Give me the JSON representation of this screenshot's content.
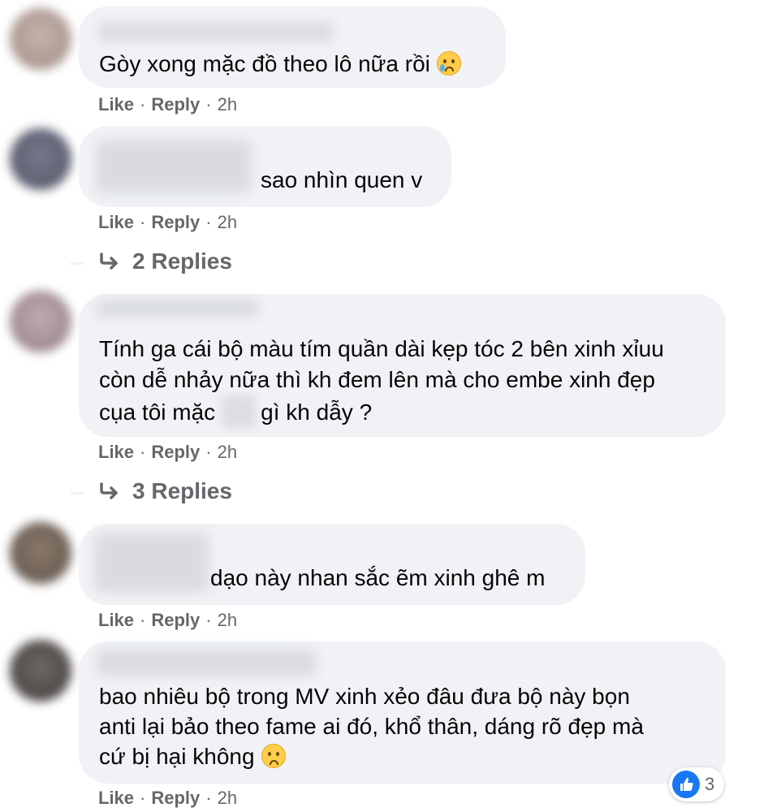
{
  "comments": [
    {
      "lines": [
        "Gòy xong mặc đồ theo lô nữa rồi"
      ],
      "emoji": "crying-smile-emoji",
      "actions": {
        "like": "Like",
        "reply": "Reply",
        "time": "2h"
      }
    },
    {
      "lines": [
        "sao nhìn quen v"
      ],
      "actions": {
        "like": "Like",
        "reply": "Reply",
        "time": "2h"
      },
      "replies": "2 Replies"
    },
    {
      "lines": [
        "Tính ga cái bộ màu tím quần dài kẹp tóc 2 bên xinh xỉuu",
        "còn dễ nhảy nữa thì kh đem lên mà cho embe xinh đẹp",
        "cụa tôi mặc",
        "gì kh dẫy ?"
      ],
      "actions": {
        "like": "Like",
        "reply": "Reply",
        "time": "2h"
      },
      "replies": "3 Replies"
    },
    {
      "lines": [
        "dạo này nhan sắc ẽm xinh ghê m"
      ],
      "actions": {
        "like": "Like",
        "reply": "Reply",
        "time": "2h"
      }
    },
    {
      "lines": [
        "bao nhiêu bộ trong MV xinh xẻo đâu đưa bộ này bọn",
        "anti lại bảo theo fame ai đó, khổ thân, dáng rõ đẹp mà",
        "cứ bị hại không"
      ],
      "emoji": "sad-face-emoji",
      "actions": {
        "like": "Like",
        "reply": "Reply",
        "time": "2h"
      },
      "reactions": {
        "icon": "like-reaction-icon",
        "count": "3"
      }
    }
  ],
  "sep": "·",
  "colors": {
    "bubble": "#f0f2f5",
    "text": "#050505",
    "secondary": "#65676b",
    "like_blue": "#1877f2"
  }
}
